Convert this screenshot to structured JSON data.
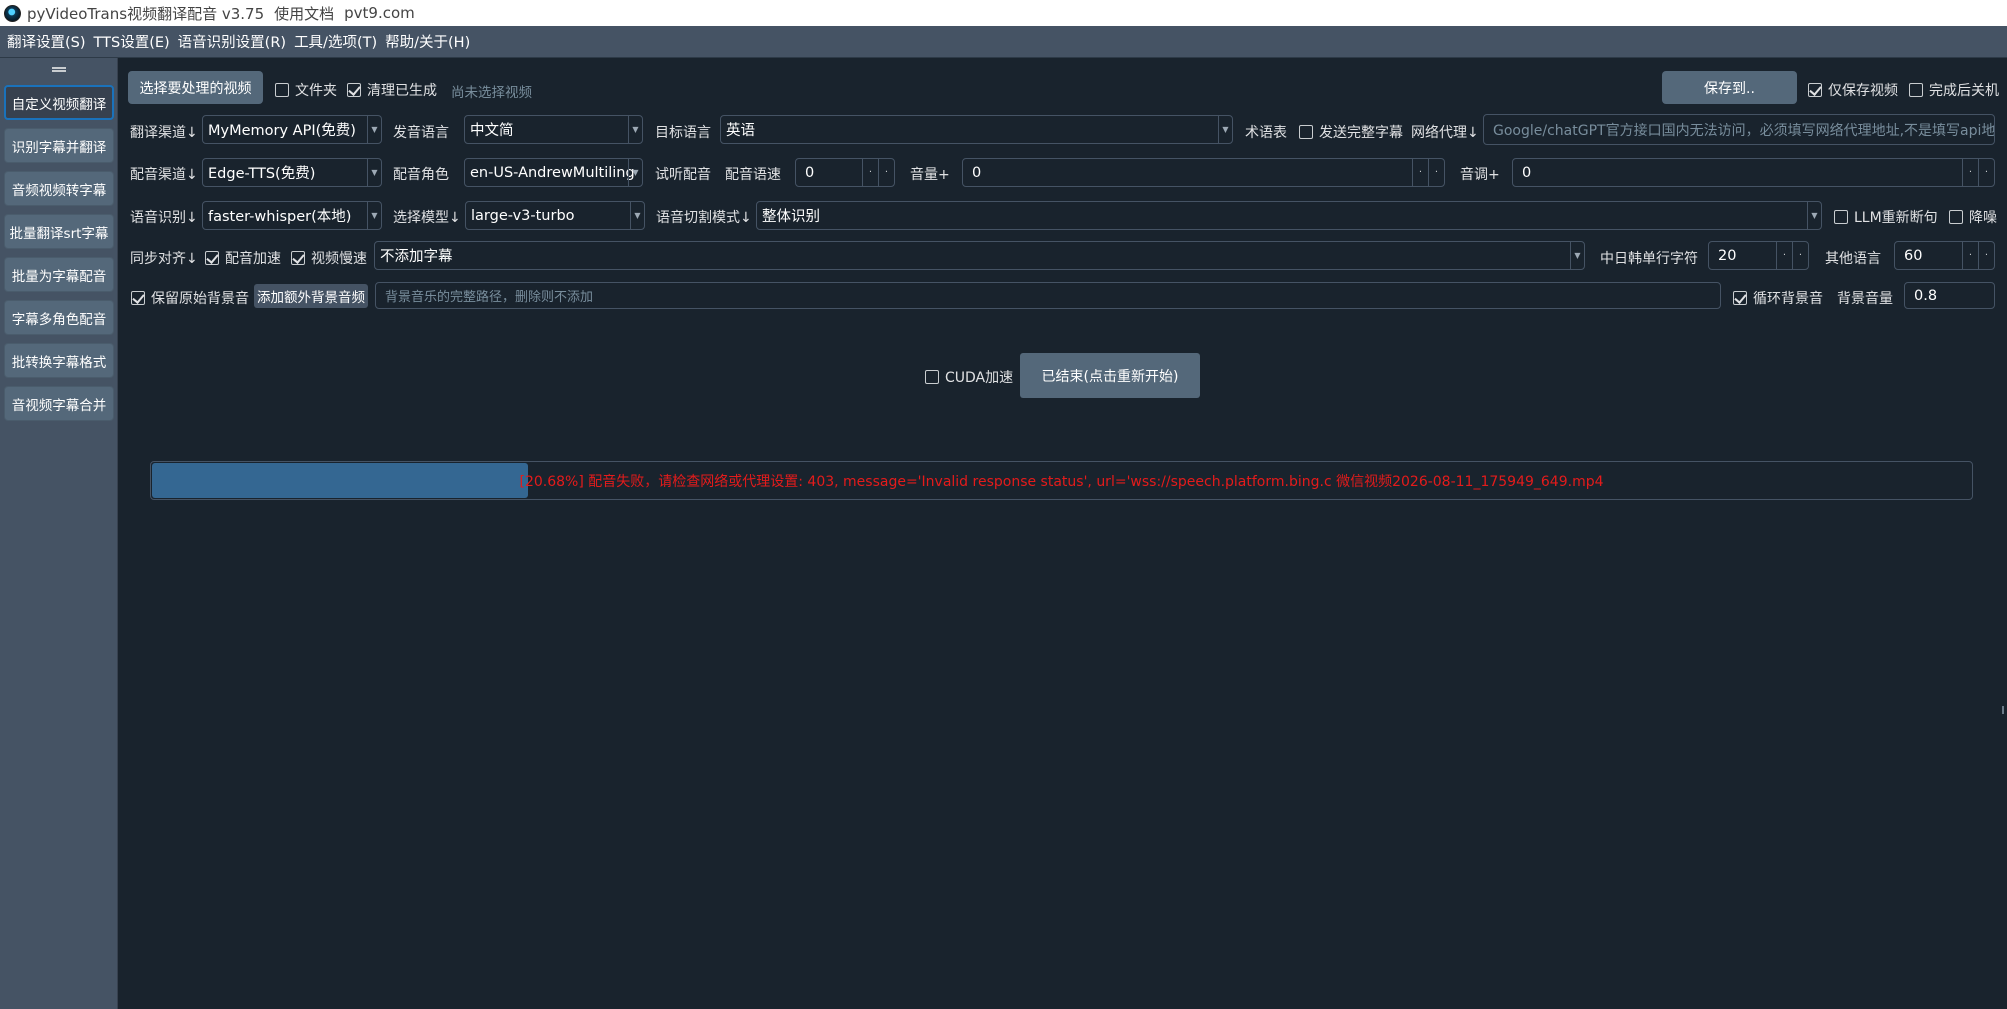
{
  "window": {
    "title": "pyVideoTrans视频翻译配音 v3.75",
    "doc_link": "使用文档",
    "site": "pvt9.com"
  },
  "menu": [
    "翻译设置(S)",
    "TTS设置(E)",
    "语音识别设置(R)",
    "工具/选项(T)",
    "帮助/关于(H)"
  ],
  "sidebar": {
    "items": [
      "自定义视频翻译",
      "识别字幕并翻译",
      "音频视频转字幕",
      "批量翻译srt字幕",
      "批量为字幕配音",
      "字幕多角色配音",
      "批转换字幕格式",
      "音视频字幕合并"
    ],
    "active_index": 0
  },
  "row1": {
    "select_video_button": "选择要处理的视频",
    "folder_label": "文件夹",
    "folder_checked": false,
    "clear_generated_label": "清理已生成",
    "clear_generated_checked": true,
    "status": "尚未选择视频",
    "save_to_button": "保存到..",
    "save_video_only_label": "仅保存视频",
    "save_video_only_checked": true,
    "shutdown_label": "完成后关机",
    "shutdown_checked": false
  },
  "row2": {
    "translate_channel_label": "翻译渠道↓",
    "translate_channel_value": "MyMemory API(免费)",
    "source_lang_label": "发音语言",
    "source_lang_value": "中文简",
    "target_lang_label": "目标语言",
    "target_lang_value": "英语",
    "glossary_label": "术语表",
    "send_full_subtitle_label": "发送完整字幕",
    "send_full_subtitle_checked": false,
    "proxy_label": "网络代理↓",
    "proxy_placeholder": "Google/chatGPT官方接口国内无法访问，必须填写网络代理地址,不是填写api地址"
  },
  "row3": {
    "dub_channel_label": "配音渠道↓",
    "dub_channel_value": "Edge-TTS(免费)",
    "voice_role_label": "配音角色",
    "voice_role_value": "en-US-AndrewMultiling",
    "preview_label": "试听配音",
    "speech_rate_label": "配音语速",
    "speech_rate_value": "0",
    "volume_label": "音量+",
    "volume_value": "0",
    "pitch_label": "音调+",
    "pitch_value": "0"
  },
  "row4": {
    "asr_label": "语音识别↓",
    "asr_value": "faster-whisper(本地)",
    "model_label": "选择模型↓",
    "model_value": "large-v3-turbo",
    "split_mode_label": "语音切割模式↓",
    "split_mode_value": "整体识别",
    "llm_resegment_label": "LLM重新断句",
    "llm_resegment_checked": false,
    "denoise_label": "降噪",
    "denoise_checked": false
  },
  "row5": {
    "sync_label": "同步对齐↓",
    "dub_speedup_label": "配音加速",
    "dub_speedup_checked": true,
    "video_slowdown_label": "视频慢速",
    "video_slowdown_checked": true,
    "subtitle_mode_value": "不添加字幕",
    "cjk_chars_label": "中日韩单行字符",
    "cjk_chars_value": "20",
    "other_lang_label": "其他语言",
    "other_lang_value": "60"
  },
  "row6": {
    "keep_bg_label": "保留原始背景音",
    "keep_bg_checked": true,
    "add_bg_button": "添加额外背景音频",
    "bg_path_placeholder": "背景音乐的完整路径，删除则不添加",
    "loop_bg_label": "循环背景音",
    "loop_bg_checked": true,
    "bg_volume_label": "背景音量",
    "bg_volume_value": "0.8"
  },
  "actions": {
    "cuda_label": "CUDA加速",
    "cuda_checked": false,
    "start_button": "已结束(点击重新开始)"
  },
  "progress": {
    "percent": 20.68,
    "text": "[20.68%]  配音失败，请检查网络或代理设置: 403, message='Invalid response status', url='wss://speech.platform.bing.c    微信视频2026-08-11_175949_649.mp4"
  },
  "colors": {
    "background": "#19232d",
    "panel": "#455364",
    "button": "#54687a",
    "accent": "#1a72bb",
    "progress_fill": "#346792",
    "error_text": "#e41b1b"
  }
}
